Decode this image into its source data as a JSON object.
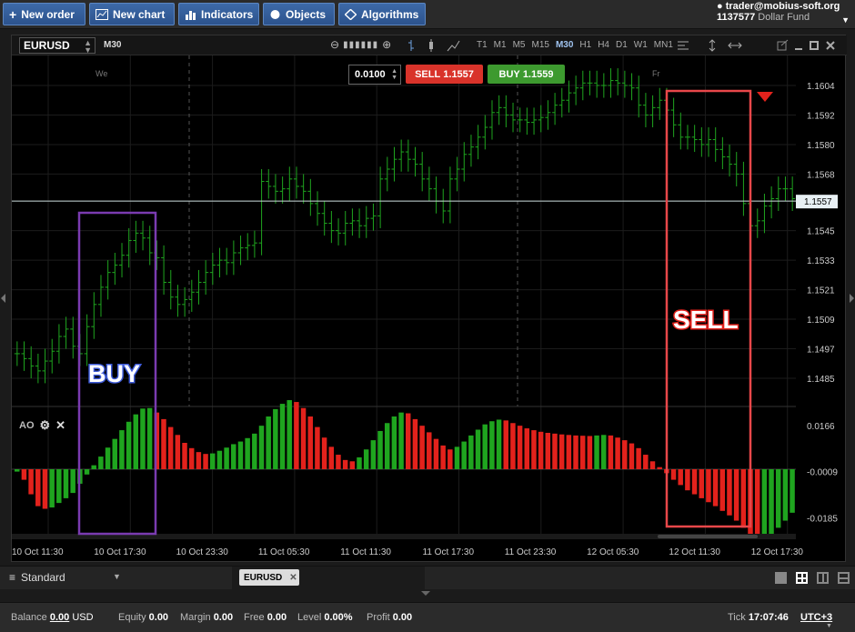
{
  "toolbar": {
    "new_order": "New order",
    "new_chart": "New chart",
    "indicators": "Indicators",
    "objects": "Objects",
    "algorithms": "Algorithms"
  },
  "account": {
    "user": "trader@mobius-soft.org",
    "number": "1137577",
    "fund": "Dollar Fund"
  },
  "chart_window": {
    "symbol": "EURUSD",
    "timeframe": "M30",
    "timeframes": [
      "T1",
      "M1",
      "M5",
      "M15",
      "M30",
      "H1",
      "H4",
      "D1",
      "W1",
      "MN1"
    ],
    "active_timeframe": "M30",
    "lot": "0.0100",
    "sell_label": "SELL",
    "sell_price": "1.1557",
    "buy_label": "BUY",
    "buy_price": "1.1559",
    "day_marker_we": "We",
    "day_marker_fr": "Fr",
    "annotation_buy": "BUY",
    "annotation_sell": "SELL",
    "indicator_name": "AO"
  },
  "chart_data": {
    "type": "bar",
    "title": "",
    "price_axis": [
      "1.1604",
      "1.1592",
      "1.1580",
      "1.1568",
      "1.1557",
      "1.1545",
      "1.1533",
      "1.1521",
      "1.1509",
      "1.1497",
      "1.1485"
    ],
    "current_price": "1.1557",
    "ao_axis": [
      "0.0166",
      "-0.0009",
      "-0.0185"
    ],
    "time_axis": [
      "10 Oct 11:30",
      "10 Oct 17:30",
      "10 Oct 23:30",
      "11 Oct 05:30",
      "11 Oct 11:30",
      "11 Oct 17:30",
      "11 Oct 23:30",
      "12 Oct 05:30",
      "12 Oct 11:30",
      "12 Oct 17:30"
    ],
    "price_closes": [
      1.1495,
      1.1493,
      1.149,
      1.1488,
      1.1492,
      1.1496,
      1.1502,
      1.1505,
      1.1498,
      1.1495,
      1.1506,
      1.1515,
      1.1522,
      1.1528,
      1.1531,
      1.1535,
      1.1541,
      1.1544,
      1.1542,
      1.1536,
      1.1534,
      1.1524,
      1.1518,
      1.1515,
      1.1517,
      1.152,
      1.1524,
      1.1528,
      1.1531,
      1.1533,
      1.1532,
      1.1536,
      1.1538,
      1.1539,
      1.154,
      1.1565,
      1.1563,
      1.1561,
      1.1562,
      1.1566,
      1.1563,
      1.1561,
      1.1556,
      1.1552,
      1.1548,
      1.1545,
      1.1544,
      1.1548,
      1.1549,
      1.1547,
      1.155,
      1.1551,
      1.1566,
      1.157,
      1.1574,
      1.1577,
      1.1574,
      1.1572,
      1.1566,
      1.1562,
      1.1557,
      1.1553,
      1.1566,
      1.157,
      1.1576,
      1.1579,
      1.1583,
      1.1587,
      1.1593,
      1.1595,
      1.1592,
      1.159,
      1.159,
      1.1589,
      1.159,
      1.1591,
      1.1593,
      1.1596,
      1.1598,
      1.1601,
      1.1603,
      1.1605,
      1.1605,
      1.1604,
      1.1604,
      1.1606,
      1.1605,
      1.1604,
      1.1603,
      1.1596,
      1.1592,
      1.1595,
      1.1598,
      1.1594,
      1.1588,
      1.1583,
      1.1583,
      1.1582,
      1.158,
      1.1582,
      1.1578,
      1.1575,
      1.1572,
      1.1568,
      1.1556,
      1.1547,
      1.1549,
      1.1555,
      1.1558,
      1.1562,
      1.1562,
      1.1558
    ],
    "ao_values": [
      -0.0009,
      -0.004,
      -0.0095,
      -0.014,
      -0.015,
      -0.0145,
      -0.0128,
      -0.011,
      -0.009,
      -0.0055,
      -0.002,
      0.0015,
      0.0048,
      0.0082,
      0.0115,
      0.0148,
      0.018,
      0.0208,
      0.023,
      0.0232,
      0.0215,
      0.019,
      0.016,
      0.013,
      0.01,
      0.008,
      0.0065,
      0.0058,
      0.006,
      0.007,
      0.0082,
      0.0095,
      0.0105,
      0.0118,
      0.0135,
      0.0165,
      0.02,
      0.0228,
      0.0248,
      0.0262,
      0.0255,
      0.0232,
      0.02,
      0.016,
      0.012,
      0.0085,
      0.0055,
      0.0035,
      0.003,
      0.0045,
      0.0075,
      0.011,
      0.0145,
      0.0175,
      0.02,
      0.0215,
      0.0212,
      0.019,
      0.0165,
      0.014,
      0.0115,
      0.009,
      0.0075,
      0.0085,
      0.0105,
      0.0128,
      0.015,
      0.017,
      0.0182,
      0.0188,
      0.0185,
      0.0175,
      0.0165,
      0.0155,
      0.0148,
      0.0142,
      0.0138,
      0.0135,
      0.0132,
      0.013,
      0.0128,
      0.0127,
      0.0126,
      0.0128,
      0.013,
      0.0128,
      0.012,
      0.011,
      0.0098,
      0.008,
      0.0055,
      0.003,
      0.0008,
      -0.0015,
      -0.004,
      -0.006,
      -0.008,
      -0.0095,
      -0.011,
      -0.0125,
      -0.014,
      -0.0158,
      -0.0175,
      -0.0195,
      -0.0222,
      -0.0252,
      -0.0262,
      -0.0258,
      -0.0245,
      -0.0222,
      -0.0195,
      -0.0165
    ]
  },
  "bottom": {
    "workspace": "Standard",
    "tab": "EURUSD"
  },
  "status": {
    "balance_label": "Balance",
    "balance": "0.00",
    "currency": "USD",
    "equity_label": "Equity",
    "equity": "0.00",
    "margin_label": "Margin",
    "margin": "0.00",
    "free_label": "Free",
    "free": "0.00",
    "level_label": "Level",
    "level": "0.00%",
    "profit_label": "Profit",
    "profit": "0.00",
    "tick_label": "Tick",
    "tick": "17:07:46",
    "tz": "UTC+3"
  },
  "colors": {
    "bull": "#1fa51f",
    "bear": "#e3221c",
    "current_price_line": "#c8d8d8",
    "buy_box": "#7a3bb0",
    "sell_box": "#e8474a"
  }
}
